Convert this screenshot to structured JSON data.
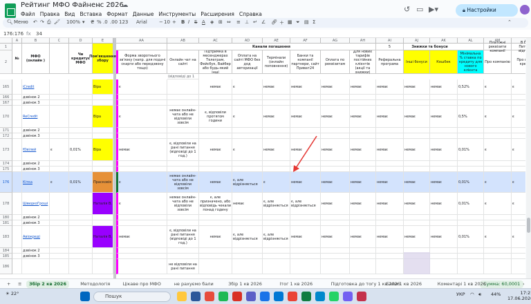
{
  "window": {
    "doc_title": "Рейтинг МФО Файненс 2026",
    "menu": [
      "Файл",
      "Правка",
      "Вид",
      "Вставка",
      "Формат",
      "Данные",
      "Инструменты",
      "Расширения",
      "Справка"
    ],
    "share_label": "Настройки Доступа"
  },
  "toolbar": {
    "search": "Меню",
    "zoom": "100%",
    "currency": "₴",
    "percent": "%",
    "dec1": ".0",
    "dec2": ".00",
    "format": "123",
    "font": "Arial",
    "font_size": "10"
  },
  "formula_bar": {
    "cell_ref": "176:176",
    "fx": "fx",
    "value": "34"
  },
  "columns": {
    "left": [
      {
        "id": "A",
        "label": "№",
        "w": 14
      },
      {
        "id": "B",
        "label": "МФО (онлайн )",
        "w": 40
      },
      {
        "id": "C",
        "label": "",
        "w": 28
      },
      {
        "id": "D",
        "label": "Чи кредитує МФО",
        "w": 34
      },
      {
        "id": "E",
        "label": "Пом'якшення збору",
        "w": 30
      }
    ],
    "right": [
      {
        "id": "AA",
        "label": "Форма зворотнього зв'язку (напр. для подачі скарги або передзвону тощо)",
        "w": 74
      },
      {
        "id": "AB",
        "label": "Онлайн чат на сайті",
        "w": 46
      },
      {
        "id": "AC",
        "label": "Підтримка в месенджерах Телеграм, Фейсбук, Вайбер або будь-який інші",
        "w": 48
      },
      {
        "id": "AD",
        "label": "Оплата на сайті МФО без дод авторизації",
        "w": 44
      },
      {
        "id": "AE",
        "label": "Термінали (онлайн поповнення)",
        "w": 40
      },
      {
        "id": "AF",
        "label": "Банки та компанії партнери, сайт Приват24",
        "w": 44
      },
      {
        "id": "AG",
        "label": "Оплата по реквізитам",
        "w": 42
      },
      {
        "id": "AH",
        "label": "Для нових тарифів постійних клієнтів (акції та знижки)",
        "w": 38
      },
      {
        "id": "AI",
        "label": "Реферальна програма",
        "w": 40
      },
      {
        "id": "AJ",
        "label": "Інші бонуси",
        "w": 38
      },
      {
        "id": "AK",
        "label": "Кешбек",
        "w": 40
      },
      {
        "id": "AL",
        "label": "Мінімальна % ставка по кредиту для нового клієнта",
        "w": 38
      },
      {
        "id": "AM",
        "label": "Про компанію",
        "w": 40
      },
      {
        "id": "AN",
        "label": "Про видачу кредиту",
        "w": 46
      }
    ],
    "group_channels": "Канали погашення",
    "group_bonus": "Знижки та бонуси",
    "group_five": "5",
    "am_row2": "Платіжні реквізити компанії",
    "an_row2": "В блоці Питання/відповідь"
  },
  "header_row2_AB_top": "(відповіді до 1 год.)",
  "rows": [
    {
      "num": "165",
      "b": "iCredit",
      "b_link": true,
      "e": "Віра",
      "e_color": "#ffff00",
      "aa": "є",
      "ac": "немає",
      "ad": "є",
      "ae": "немає",
      "af": "немає",
      "ag": "немає",
      "ah": "немає",
      "ai": "немає",
      "aj": "немає",
      "ak": "немає",
      "al": "0,52%",
      "am": "є",
      "an": "є"
    },
    {
      "num": "166",
      "b": "дзвінок 2"
    },
    {
      "num": "167",
      "b": "дзвінок 3"
    },
    {
      "num": "170",
      "b": "ReCredit",
      "b_link": true,
      "e": "Віра",
      "e_color": "#ffff00",
      "aa": "є",
      "ab": "немає онлайн-чата або не відповіли зовсім",
      "ac": "є, відповіли протягом години",
      "ad": "є",
      "ae": "немає",
      "af": "немає",
      "ag": "немає",
      "ah": "немає",
      "ai": "немає",
      "aj": "немає",
      "ak": "немає",
      "al": "0,5%",
      "am": "є",
      "an": "є"
    },
    {
      "num": "171",
      "b": "дзвінок 2"
    },
    {
      "num": "172",
      "b": "дзвінок 3"
    },
    {
      "num": "173",
      "b": "Ювілей",
      "b_link": true,
      "c": "є",
      "d": "0,01%",
      "e": "Віра",
      "e_color": "#ffff00",
      "aa": "немає",
      "ab": "є, відповіли на рані питання (відповіді до 1 год.)",
      "ac": "немає",
      "ad": "є",
      "ae": "немає",
      "af": "немає",
      "ag": "немає",
      "ah": "немає",
      "ai": "немає",
      "aj": "немає",
      "ak": "немає",
      "al": "0,01%",
      "am": "є",
      "an": "є"
    },
    {
      "num": "174",
      "b": "дзвінок 2"
    },
    {
      "num": "175",
      "b": "дзвінок 3"
    },
    {
      "num": "176",
      "b": "Кітка",
      "b_link": true,
      "c": "є",
      "d": "0,01%",
      "e": "Прасковія",
      "e_color": "#e69138",
      "aa": "є",
      "ab": "немає онлайн-чата або не відповіли зовсім",
      "ac": "немає",
      "ad": "є, але відрізняється",
      "ae": "є",
      "af": "немає",
      "ag": "немає",
      "ah": "немає",
      "ai": "немає",
      "aj": "немає",
      "ak": "немає",
      "al": "0,01%",
      "am": "є",
      "an": "є",
      "selected": true
    },
    {
      "num": "178",
      "b": "ШвидкоГроші",
      "b_link": true,
      "e": "Наталія В.",
      "e_color": "#9900ff",
      "aa": "є",
      "ab": "немає онлайн-чата або не відповіли зовсім",
      "ac": "є, але призначено, або відповідь чекали понад годину",
      "ad": "немає",
      "ae": "є, але відрізняється",
      "af": "є, але відрізняється",
      "ag": "немає",
      "ah": "немає",
      "ai": "немає",
      "aj": "немає",
      "ak": "немає",
      "al": "0,01%",
      "am": "є",
      "an": "є"
    },
    {
      "num": "180",
      "b": "дзвінок 2"
    },
    {
      "num": "181",
      "b": "дзвінок 3"
    },
    {
      "num": "183",
      "b": "Авіокреді",
      "b_link": true,
      "e": "Наталія В.",
      "e_color": "#9900ff",
      "aa": "немає",
      "ab": "є, відповіли на рані питання (відповіді до 1 год.)",
      "ac": "немає",
      "ad": "є, але відрізняється",
      "ae": "є, але відрізняється",
      "af": "немає",
      "ag": "немає",
      "ah": "немає",
      "ai": "немає",
      "aj": "немає",
      "ak": "немає",
      "al": "0,01%",
      "am": "є",
      "an": "є"
    },
    {
      "num": "184",
      "b": "дзвінок 2"
    },
    {
      "num": "185",
      "b": "дзвінок 3"
    },
    {
      "num": "186",
      "b": "",
      "ab": "не відповіли на рані питання"
    }
  ],
  "tabs": [
    "Збір 2 кв 2026",
    "Методологія",
    "Цікаве про МФО",
    "не рахуємо бали",
    "Збір 1 кв 2026",
    "Ітог 1 кв 2026",
    "Підготовка до тогу 1 кв 2026",
    "Бали 1 кв 2026",
    "Коментарі 1 кв 2026"
  ],
  "sum_chip": "Сумма: 60,0001",
  "taskbar": {
    "weather": "22°",
    "search": "Пошук",
    "lang": "УКР",
    "battery": "44%",
    "time": "17:21",
    "date": "17.06.2026"
  },
  "colors": {
    "accent": "#0b57d0",
    "share_bg": "#c2e7ff",
    "header_yellow": "#ffff00",
    "header_cyan": "#00ffff",
    "header_magenta": "#ff00ff",
    "arrow_red": "#e53935",
    "selection": "#d3e3fd"
  }
}
